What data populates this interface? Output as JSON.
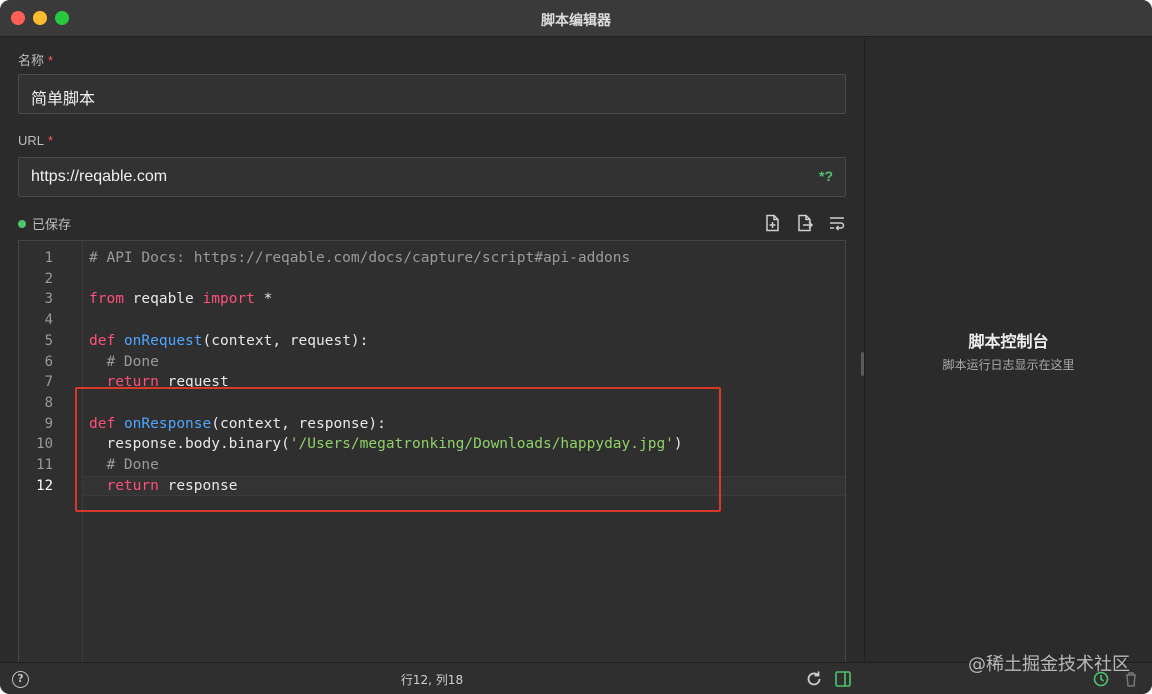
{
  "window": {
    "title": "脚本编辑器"
  },
  "form": {
    "name_label": "名称",
    "name_required": "*",
    "name_value": "简单脚本",
    "url_label": "URL",
    "url_required": "*",
    "url_value": "https://reqable.com",
    "url_wildcard_icon": "*?",
    "status_label": "已保存"
  },
  "toolbar": {
    "icons": [
      "new-file-icon",
      "export-file-icon",
      "wrap-lines-icon"
    ]
  },
  "editor": {
    "line_numbers": [
      "1",
      "2",
      "3",
      "4",
      "5",
      "6",
      "7",
      "8",
      "9",
      "10",
      "11",
      "12"
    ],
    "active_line": 12
  },
  "console": {
    "title": "脚本控制台",
    "subtitle": "脚本运行日志显示在这里"
  },
  "statusbar": {
    "help_icon": "?",
    "cursor_position": "行12, 列18"
  },
  "watermark": "@稀土掘金技术社区",
  "colors": {
    "accent_green": "#4ec46d",
    "required_red": "#ff5a5a",
    "highlight_red": "#d8392b",
    "keyword": "#ff4f7b",
    "function": "#4ea5ff",
    "string": "#8fd069"
  }
}
